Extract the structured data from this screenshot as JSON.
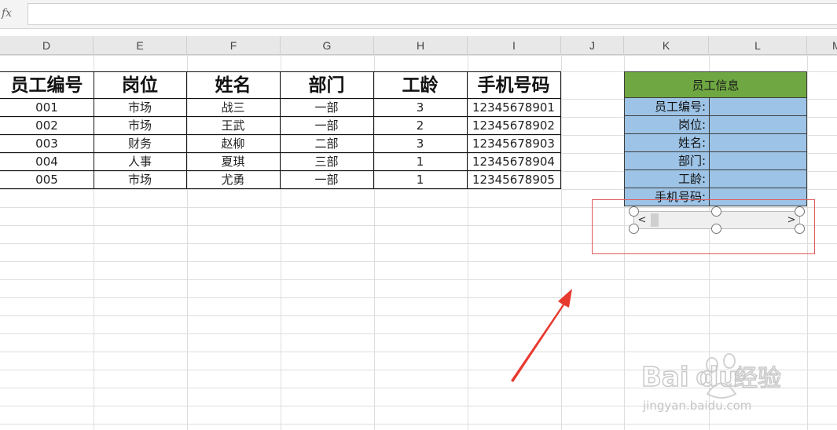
{
  "formula_bar": {
    "fx_label": "fx",
    "value": ""
  },
  "columns": [
    "D",
    "E",
    "F",
    "G",
    "H",
    "I",
    "J",
    "K",
    "L",
    "M"
  ],
  "table": {
    "headers": [
      "员工编号",
      "岗位",
      "姓名",
      "部门",
      "工龄",
      "手机号码"
    ],
    "rows": [
      [
        "001",
        "市场",
        "战三",
        "一部",
        "3",
        "12345678901"
      ],
      [
        "002",
        "市场",
        "王武",
        "一部",
        "2",
        "12345678902"
      ],
      [
        "003",
        "财务",
        "赵柳",
        "二部",
        "3",
        "12345678903"
      ],
      [
        "004",
        "人事",
        "夏琪",
        "三部",
        "1",
        "12345678904"
      ],
      [
        "005",
        "市场",
        "尤勇",
        "一部",
        "1",
        "12345678905"
      ]
    ]
  },
  "info_box": {
    "title": "员工信息",
    "labels": [
      "员工编号:",
      "岗位:",
      "姓名:",
      "部门:",
      "工龄:",
      "手机号码:"
    ]
  },
  "scroll_control": {
    "left_arrow": "<",
    "right_arrow": ">"
  },
  "watermark": {
    "brand": "Bai",
    "brand2": "du",
    "cn": "经验",
    "url": "jingyan.baidu.com"
  },
  "colors": {
    "title_green": "#6fa842",
    "info_blue": "#9dc3e6",
    "arrow_red": "#e8392f",
    "outline_red": "#e05a5a"
  }
}
